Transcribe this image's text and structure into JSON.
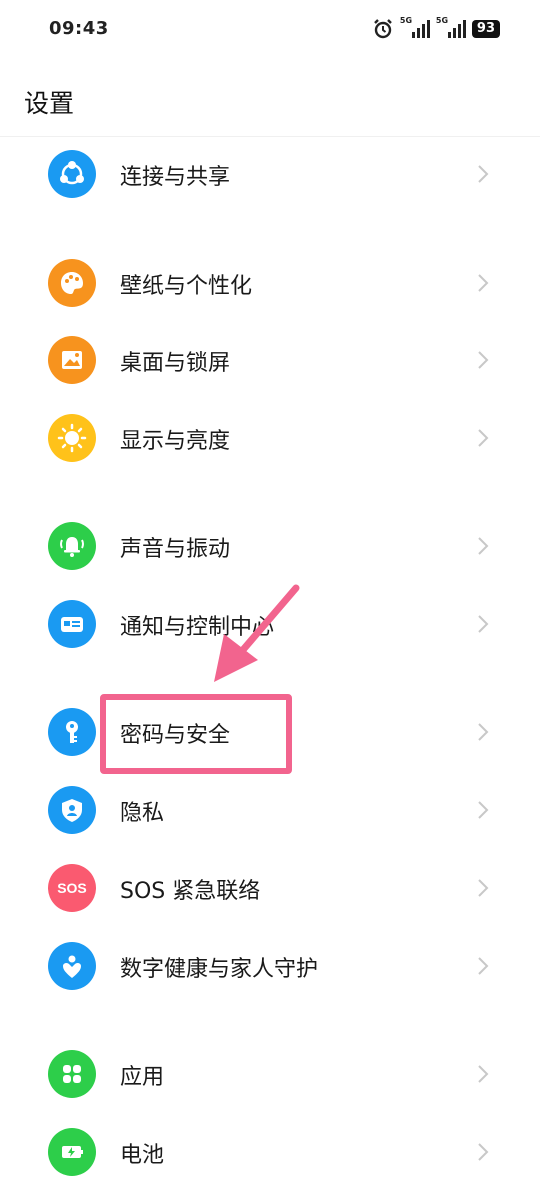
{
  "status_bar": {
    "time": "09:43",
    "sim1_label": "5G",
    "sim2_label": "5G",
    "battery": "93"
  },
  "header": {
    "title": "设置"
  },
  "settings": [
    {
      "id": "connect-share",
      "label": "连接与共享",
      "icon": "share-icon",
      "color": "#1a9af2"
    },
    {
      "id": "wallpaper",
      "label": "壁纸与个性化",
      "icon": "palette-icon",
      "color": "#f7931e"
    },
    {
      "id": "desktop-lock",
      "label": "桌面与锁屏",
      "icon": "image-icon",
      "color": "#f7931e"
    },
    {
      "id": "display",
      "label": "显示与亮度",
      "icon": "sun-icon",
      "color": "#ffc21a"
    },
    {
      "id": "sound",
      "label": "声音与振动",
      "icon": "bell-icon",
      "color": "#2dce4a"
    },
    {
      "id": "notification",
      "label": "通知与控制中心",
      "icon": "notification-panel-icon",
      "color": "#1a9af2"
    },
    {
      "id": "password",
      "label": "密码与安全",
      "icon": "key-icon",
      "color": "#1a9af2"
    },
    {
      "id": "privacy",
      "label": "隐私",
      "icon": "shield-user-icon",
      "color": "#1a9af2"
    },
    {
      "id": "sos",
      "label": "SOS 紧急联络",
      "icon": "sos-icon",
      "icon_text": "SOS",
      "color": "#fa5a70"
    },
    {
      "id": "digital-health",
      "label": "数字健康与家人守护",
      "icon": "heart-person-icon",
      "color": "#1a9af2"
    },
    {
      "id": "apps",
      "label": "应用",
      "icon": "apps-grid-icon",
      "color": "#2dce4a"
    },
    {
      "id": "battery",
      "label": "电池",
      "icon": "battery-icon",
      "color": "#2dce4a"
    }
  ],
  "annotation": {
    "highlight_color": "#f2648e"
  }
}
